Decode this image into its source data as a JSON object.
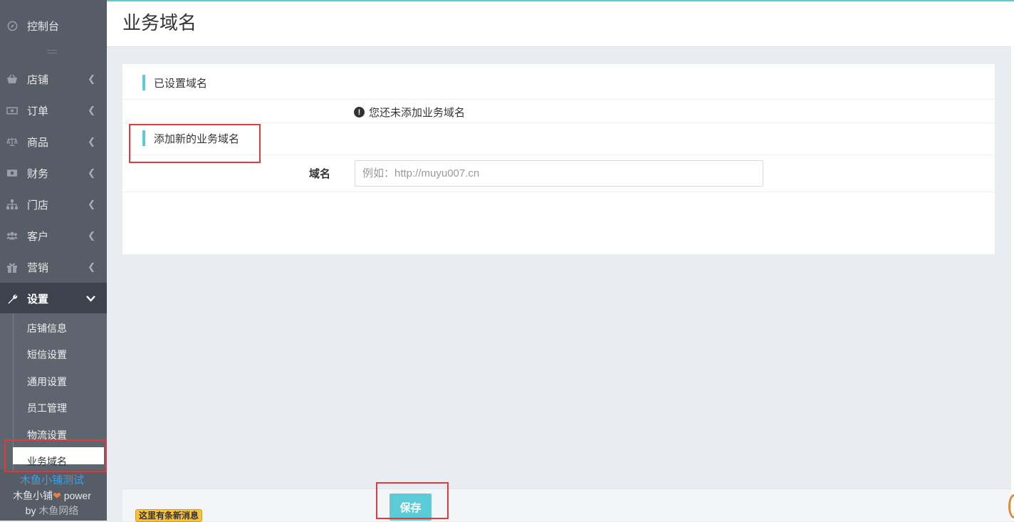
{
  "sidebar": {
    "console": "控制台",
    "items": [
      {
        "label": "店铺",
        "icon": "basket-icon"
      },
      {
        "label": "订单",
        "icon": "money-icon"
      },
      {
        "label": "商品",
        "icon": "scale-icon"
      },
      {
        "label": "财务",
        "icon": "cash-icon"
      },
      {
        "label": "门店",
        "icon": "sitemap-icon"
      },
      {
        "label": "客户",
        "icon": "users-icon"
      },
      {
        "label": "营销",
        "icon": "gift-icon"
      },
      {
        "label": "设置",
        "icon": "wrench-icon"
      }
    ],
    "submenu": [
      "店铺信息",
      "短信设置",
      "通用设置",
      "员工管理",
      "物流设置",
      "业务域名"
    ],
    "footer": {
      "line1": "木鱼小铺测试",
      "line2_prefix": "木鱼小铺",
      "line2_suffix": "power",
      "line3_by": "by",
      "line3_company": "木鱼网络"
    }
  },
  "header": {
    "title": "业务域名"
  },
  "panel": {
    "section1_title": "已设置域名",
    "notice": "您还未添加业务域名",
    "section2_title": "添加新的业务域名",
    "field_label": "域名",
    "field_placeholder": "例如：http://muyu007.cn",
    "field_value": ""
  },
  "footer": {
    "save_label": "保存",
    "message_badge": "这里有条新消息"
  },
  "colors": {
    "accent": "#5bcbd8",
    "sidebar_bg": "#565d66",
    "highlight_box": "#e2393f"
  }
}
